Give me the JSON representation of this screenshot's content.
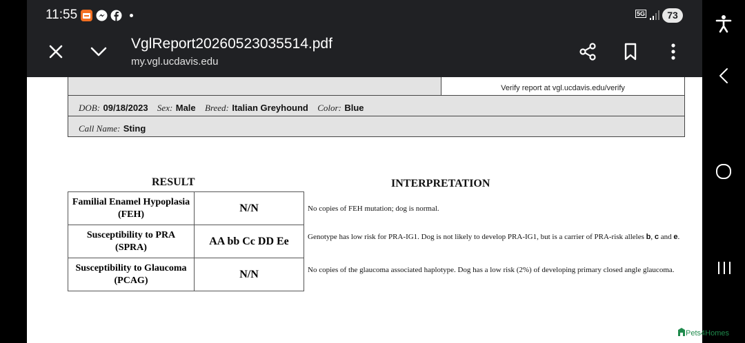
{
  "status_bar": {
    "time": "11:55",
    "network": "5G",
    "battery": "73"
  },
  "app_bar": {
    "title": "VglReport20260523035514.pdf",
    "url": "my.vgl.ucdavis.edu"
  },
  "report": {
    "verify_text": "Verify report at vgl.ucdavis.edu/verify",
    "dob_label": "DOB:",
    "dob": "09/18/2023",
    "sex_label": "Sex:",
    "sex": "Male",
    "breed_label": "Breed:",
    "breed": "Italian Greyhound",
    "color_label": "Color:",
    "color": "Blue",
    "call_name_label": "Call Name:",
    "call_name": "Sting",
    "result_heading": "RESULT",
    "interpretation_heading": "INTERPRETATION",
    "rows": [
      {
        "test_line1": "Familial Enamel Hypoplasia",
        "test_line2": "(FEH)",
        "result": "N/N",
        "interpretation": "No copies of FEH mutation; dog is normal."
      },
      {
        "test_line1": "Susceptibility to PRA",
        "test_line2": "(SPRA)",
        "result": "AA bb Cc DD Ee",
        "interp_part1": "Genotype has low risk for PRA-IG1. Dog is not likely to develop PRA-IG1, but is a carrier of PRA-risk alleles ",
        "allele_b": "b",
        "sep1": ", ",
        "allele_c": "c",
        "sep2": " and ",
        "allele_e": "e",
        "end": "."
      },
      {
        "test_line1": "Susceptibility to Glaucoma",
        "test_line2": "(PCAG)",
        "result": "N/N",
        "interpretation": "No copies of the glaucoma associated haplotype. Dog has a low risk (2%) of developing primary closed angle glaucoma."
      }
    ]
  },
  "watermark": {
    "text": "Pets4Homes",
    "color": "#1f8a4c"
  },
  "colors": {
    "app_bar": "#202124",
    "header_gray": "#e3e3e3"
  }
}
